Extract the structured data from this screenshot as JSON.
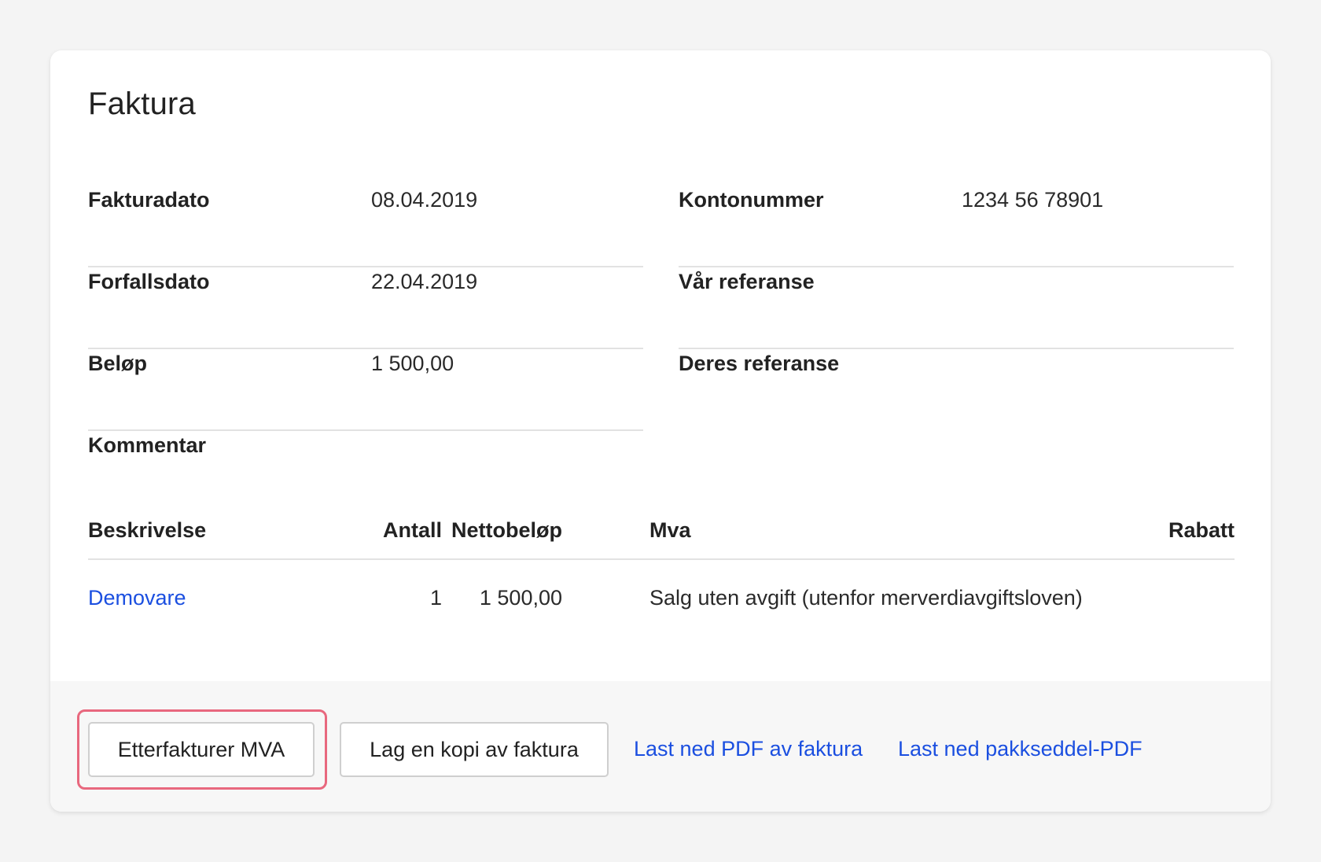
{
  "title": "Faktura",
  "info_left": [
    {
      "label": "Fakturadato",
      "value": "08.04.2019"
    },
    {
      "label": "Forfallsdato",
      "value": "22.04.2019"
    },
    {
      "label": "Beløp",
      "value": "1 500,00"
    }
  ],
  "info_right": [
    {
      "label": "Kontonummer",
      "value": "1234 56 78901"
    },
    {
      "label": "Vår referanse",
      "value": ""
    },
    {
      "label": "Deres referanse",
      "value": ""
    }
  ],
  "comment_label": "Kommentar",
  "table": {
    "headers": {
      "description": "Beskrivelse",
      "quantity": "Antall",
      "net_amount": "Nettobeløp",
      "vat": "Mva",
      "discount": "Rabatt"
    },
    "rows": [
      {
        "description": "Demovare",
        "quantity": "1",
        "net_amount": "1 500,00",
        "vat": "Salg uten avgift (utenfor merverdiavgiftsloven)",
        "discount": ""
      }
    ]
  },
  "footer": {
    "rebill_vat_label": "Etterfakturer MVA",
    "copy_invoice_label": "Lag en kopi av faktura",
    "download_pdf_label": "Last ned PDF av faktura",
    "download_packing_slip_label": "Last ned pakkseddel-PDF"
  },
  "colors": {
    "link": "#1b4fe0",
    "highlight": "#e8687e"
  }
}
